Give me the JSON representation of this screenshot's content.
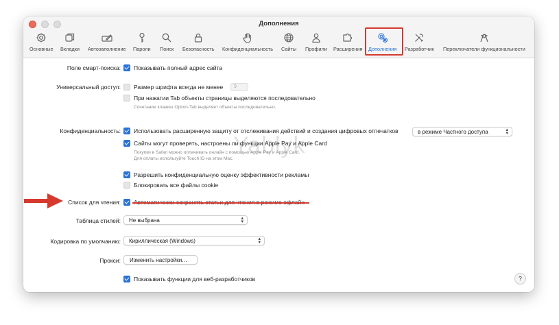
{
  "window": {
    "title": "Дополнения"
  },
  "toolbar": {
    "tabs": [
      {
        "label": "Основные",
        "icon": "gear-icon"
      },
      {
        "label": "Вкладки",
        "icon": "tabs-icon"
      },
      {
        "label": "Автозаполнение",
        "icon": "pencil-field-icon"
      },
      {
        "label": "Пароли",
        "icon": "key-icon"
      },
      {
        "label": "Поиск",
        "icon": "search-icon"
      },
      {
        "label": "Безопасность",
        "icon": "lock-icon"
      },
      {
        "label": "Конфиденциальность",
        "icon": "hand-icon"
      },
      {
        "label": "Сайты",
        "icon": "globe-icon"
      },
      {
        "label": "Профили",
        "icon": "person-icon"
      },
      {
        "label": "Расширения",
        "icon": "puzzle-icon"
      },
      {
        "label": "Дополнения",
        "icon": "gears-icon"
      },
      {
        "label": "Разработчик",
        "icon": "tools-icon"
      },
      {
        "label": "Переключатели функциональности",
        "icon": "flags-icon"
      }
    ],
    "active_tab": "Дополнения"
  },
  "settings": {
    "smart_search": {
      "label": "Поле смарт-поиска:",
      "checkbox": "Показывать полный адрес сайта",
      "checked": true
    },
    "accessibility": {
      "label": "Универсальный доступ:",
      "font_size": "Размер шрифта всегда не менее",
      "font_size_value": "9",
      "tab_highlight": "При нажатии Tab объекты страницы выделяются последовательно",
      "hint": "Сочетание клавиш Option-Tab выделяет объекты последовательно."
    },
    "privacy": {
      "label": "Конфиденциальность:",
      "advanced_tracking": "Использовать расширенную защиту от отслеживания действий и создания цифровых отпечатков",
      "tracking_mode": "в режиме Частного доступа",
      "apple_pay": "Сайты могут проверять, настроены ли функции Apple Pay и Apple Card",
      "apple_pay_hint_1": "Покупки в Safari можно оплачивать онлайн с помощью Apple Pay и Apple Card.",
      "apple_pay_hint_2": "Для оплаты используйте Touch ID на этом Mac.",
      "ad_measurement": "Разрешить конфиденциальную оценку эффективности рекламы",
      "block_cookies": "Блокировать все файлы cookie"
    },
    "reading_list": {
      "label": "Список для чтения:",
      "checkbox": "Автоматически сохранять статьи для чтения в режиме офлайн"
    },
    "stylesheet": {
      "label": "Таблица стилей:",
      "value": "Не выбрана"
    },
    "encoding": {
      "label": "Кодировка по умолчанию:",
      "value": "Кириллическая (Windows)"
    },
    "proxies": {
      "label": "Прокси:",
      "button": "Изменить настройки…"
    },
    "developer": {
      "checkbox": "Показывать функции для веб-разработчиков"
    }
  },
  "help_label": "?",
  "watermark": "Yablyk",
  "colors": {
    "accent": "#2a72d6",
    "highlight": "#d63a2f"
  }
}
